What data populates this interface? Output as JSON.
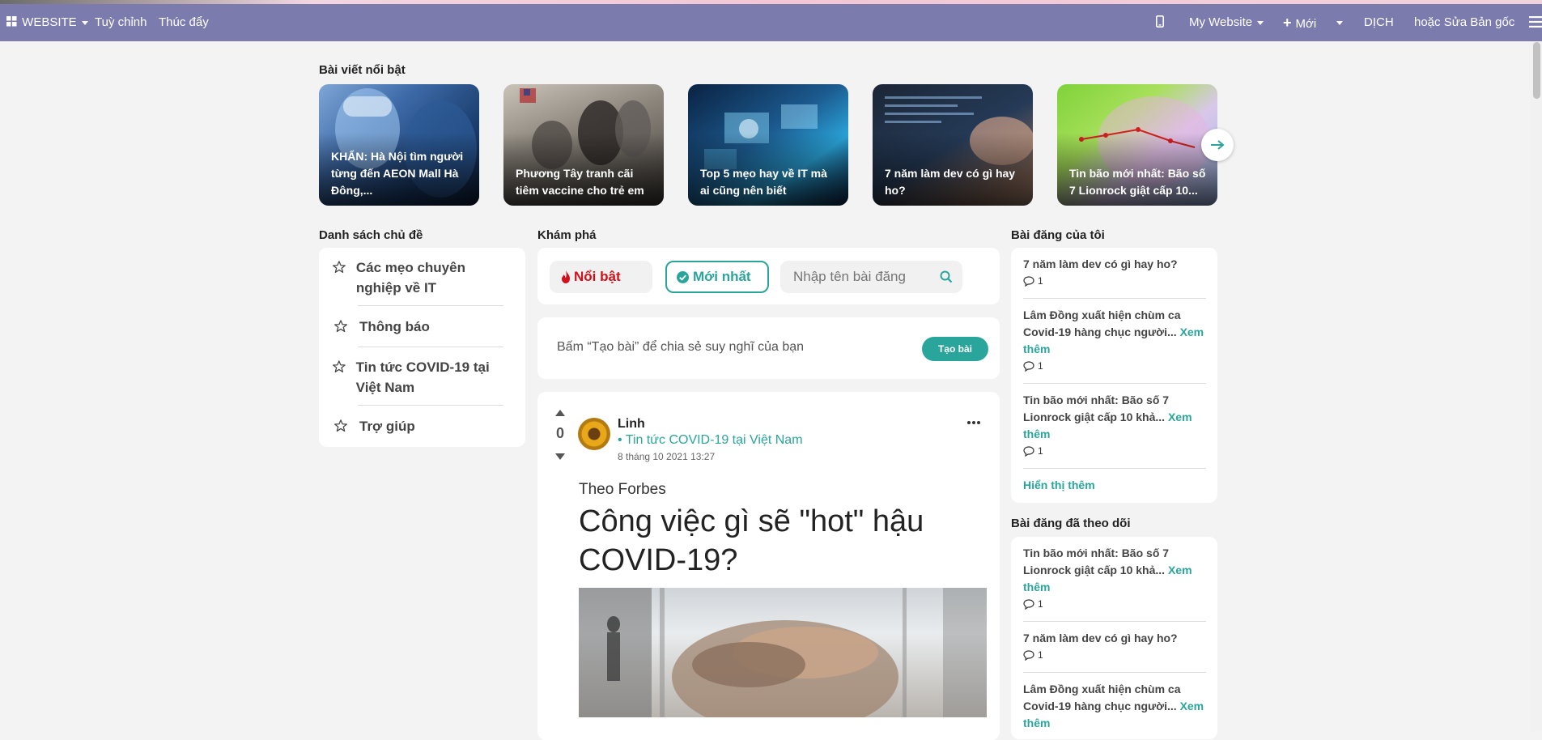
{
  "topbar": {
    "apps_label": "WEBSITE",
    "menu_customize": "Tuỳ chỉnh",
    "menu_promote": "Thúc đẩy",
    "website_switch": "My Website",
    "new_label": "Mới",
    "translate_label": "DỊCH",
    "edit_label": "hoặc Sửa Bản gốc",
    "bg_color": "#7c7bad"
  },
  "featured": {
    "title": "Bài viết nổi bật",
    "items": [
      {
        "title": "KHẨN: Hà Nội tìm người từng đến AEON Mall Hà Đông,...",
        "image": "medical-worker"
      },
      {
        "title": "Phương Tây tranh cãi tiêm vaccine cho trẻ em",
        "image": "vaccination-room"
      },
      {
        "title": "Top 5 mẹo hay về IT mà ai cũng nên biết",
        "image": "tech-screens"
      },
      {
        "title": "7 năm làm dev có gì hay ho?",
        "image": "coding-laptop"
      },
      {
        "title": "Tin bão mới nhất: Bão số 7 Lionrock giật cấp 10...",
        "image": "storm-map"
      }
    ]
  },
  "topics": {
    "title": "Danh sách chủ đề",
    "items": [
      {
        "label": "Các mẹo chuyên nghiệp về IT"
      },
      {
        "label": "Thông báo"
      },
      {
        "label": "Tin tức COVID-19 tại Việt Nam"
      },
      {
        "label": "Trợ giúp"
      }
    ]
  },
  "explore": {
    "title": "Khám phá",
    "tab_featured": "Nổi bật",
    "tab_newest": "Mới nhất",
    "search_placeholder": "Nhập tên bài đăng",
    "compose_hint": "Bấm “Tạo bài” để chia sẻ suy nghĩ của bạn",
    "compose_button": "Tạo bài"
  },
  "post": {
    "votes": "0",
    "author": "Linh",
    "topic": "• Tin tức COVID-19 tại Việt Nam",
    "date": "8 tháng 10 2021 13:27",
    "source": "Theo Forbes",
    "headline": "Công việc gì sẽ \"hot\" hậu COVID-19?",
    "image": "hands-teamwork"
  },
  "my_posts": {
    "title": "Bài đăng của tôi",
    "items": [
      {
        "text": "7 năm làm dev có gì hay ho?",
        "more": "",
        "comments": "1"
      },
      {
        "text": "Lâm Đồng xuất hiện chùm ca Covid-19 hàng chục người...",
        "more": "Xem thêm",
        "comments": "1"
      },
      {
        "text": "Tin bão mới nhất: Bão số 7 Lionrock giật cấp 10 khả...",
        "more": "Xem thêm",
        "comments": "1"
      }
    ],
    "show_more": "Hiển thị thêm"
  },
  "followed_posts": {
    "title": "Bài đăng đã theo dõi",
    "items": [
      {
        "text": "Tin bão mới nhất: Bão số 7 Lionrock giật cấp 10 khả...",
        "more": "Xem thêm",
        "comments": "1"
      },
      {
        "text": "7 năm làm dev có gì hay ho?",
        "more": "",
        "comments": "1"
      },
      {
        "text": "Lâm Đồng xuất hiện chùm ca Covid-19 hàng chục người...",
        "more": "Xem thêm",
        "comments": ""
      }
    ]
  },
  "colors": {
    "accent": "#2aa59b",
    "featured_red": "#d0101a",
    "page_bg": "#f3f3f4"
  }
}
